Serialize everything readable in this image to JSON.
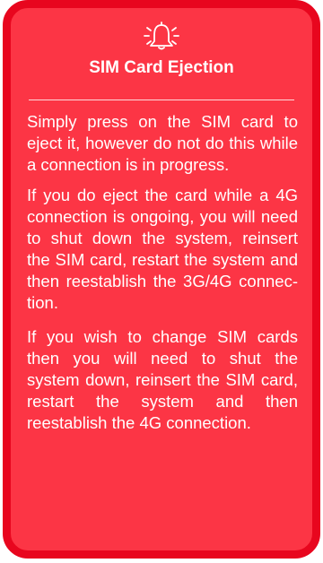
{
  "callout": {
    "icon": "bell-alarm-icon",
    "title": "SIM Card Ejection",
    "paragraphs": [
      "Simply press on the SIM card to eject it, however do not do this while a connection is in prog­ress.",
      "If you do eject the card while a 4G connection is ongoing, you will need to shut down the sys­tem, reinsert the SIM card, re­start the system and then reestablish the 3G/4G connec­tion.",
      "If you wish to change SIM cards then you will need to shut the system down, reinsert the SIM card, restart the system and then reestablish the 4G connec­tion."
    ],
    "colors": {
      "fill": "#fc3545",
      "border": "#e8061e",
      "text": "#ffffff"
    }
  }
}
